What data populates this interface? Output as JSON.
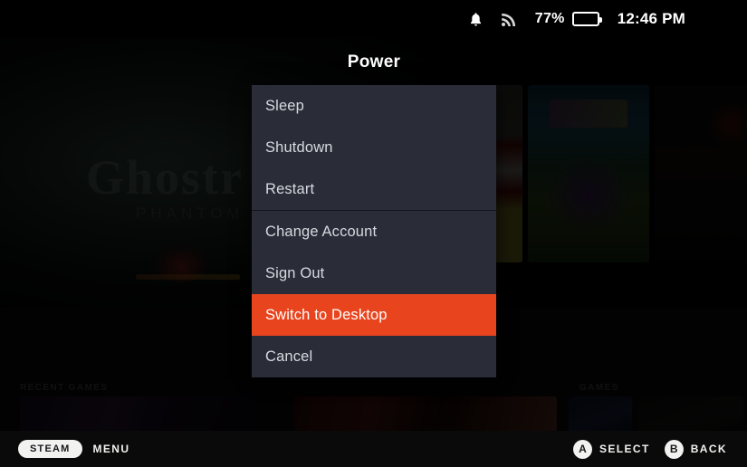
{
  "status_bar": {
    "notification_icon": "bell-icon",
    "network_icon": "wifi-signal-icon",
    "battery_percent_label": "77%",
    "battery_level": 77,
    "battery_fill_color": "#4ac22e",
    "clock": "12:46 PM"
  },
  "power_menu": {
    "title": "Power",
    "highlight_color": "#e8441e",
    "panel_color": "#2a2d38",
    "items": [
      {
        "label": "Sleep",
        "selected": false,
        "divider_after": false
      },
      {
        "label": "Shutdown",
        "selected": false,
        "divider_after": false
      },
      {
        "label": "Restart",
        "selected": false,
        "divider_after": true
      },
      {
        "label": "Change Account",
        "selected": false,
        "divider_after": false
      },
      {
        "label": "Sign Out",
        "selected": false,
        "divider_after": false
      },
      {
        "label": "Switch to Desktop",
        "selected": true,
        "divider_after": false
      },
      {
        "label": "Cancel",
        "selected": false,
        "divider_after": false
      }
    ]
  },
  "background": {
    "hero_title": "Ghostr",
    "hero_subtitle": "PHANTOM",
    "shelf_label_1": "RECENT GAMES",
    "shelf_label_2": "GAMES"
  },
  "bottom_bar": {
    "steam_pill": "STEAM",
    "steam_action": "MENU",
    "hints": [
      {
        "button": "A",
        "label": "SELECT"
      },
      {
        "button": "B",
        "label": "BACK"
      }
    ]
  }
}
